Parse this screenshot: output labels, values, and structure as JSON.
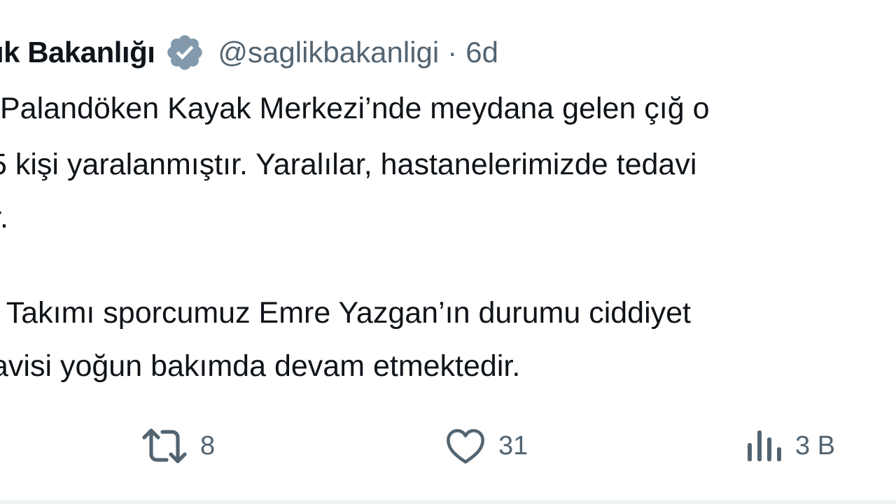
{
  "tweet": {
    "display_name": "ık Bakanlığı",
    "handle": "@saglikbakanligi",
    "separator": "·",
    "time": "6d",
    "lines": [
      "Palandöken Kayak Merkezi’nde meydana gelen çığ o",
      "5 kişi yaralanmıştır. Yaralılar, hastanelerimizde tedavi",
      "r.",
      "i Takımı sporcumuz Emre Yazgan’ın durumu ciddiyet",
      "avisi yoğun bakımda devam etmektedir."
    ]
  },
  "actions": {
    "retweet_count": "8",
    "like_count": "31",
    "views_count": "3 B"
  },
  "icons": {
    "verified": "verified-badge-icon",
    "retweet": "retweet-icon",
    "like": "heart-icon",
    "views": "bar-chart-icon"
  },
  "colors": {
    "text": "#0f1419",
    "muted": "#536471",
    "verified_badge": "#829aab"
  }
}
